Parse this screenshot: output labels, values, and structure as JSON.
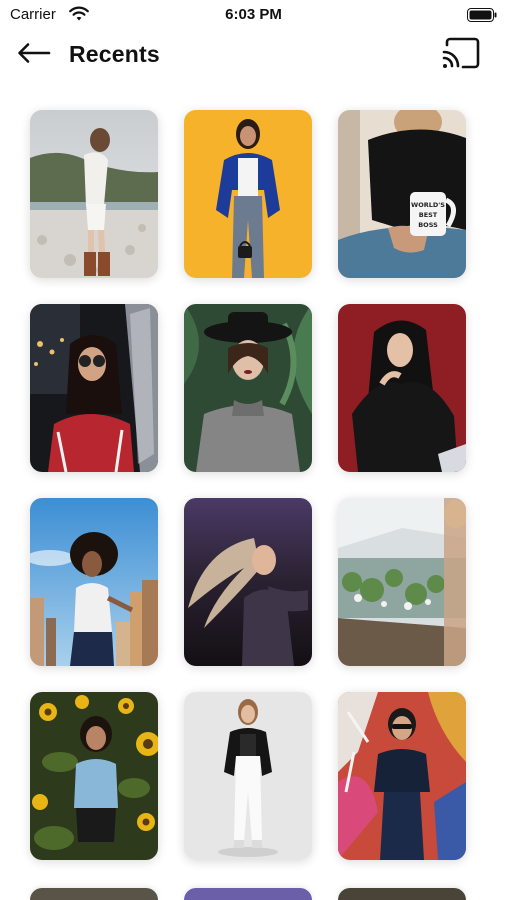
{
  "status_bar": {
    "carrier": "Carrier",
    "time": "6:03 PM"
  },
  "header": {
    "title": "Recents",
    "back_icon": "arrow-left-icon",
    "cast_icon": "cast-icon"
  },
  "photos": [
    {
      "subject": "woman-on-rocky-beach"
    },
    {
      "subject": "woman-in-blue-blazer-yellow-wall"
    },
    {
      "subject": "person-holding-mug"
    },
    {
      "subject": "woman-in-sunglasses-night"
    },
    {
      "subject": "woman-in-black-hat"
    },
    {
      "subject": "woman-in-black-sweater-red-wall"
    },
    {
      "subject": "woman-city-blue-sky"
    },
    {
      "subject": "woman-hair-flip-dark"
    },
    {
      "subject": "plant-market"
    },
    {
      "subject": "woman-in-sunflower-field"
    },
    {
      "subject": "woman-in-white-pants-studio"
    },
    {
      "subject": "woman-in-front-of-graffiti"
    }
  ],
  "mug_text": {
    "line1": "WORLD'S",
    "line2": "BEST",
    "line3": "BOSS"
  }
}
